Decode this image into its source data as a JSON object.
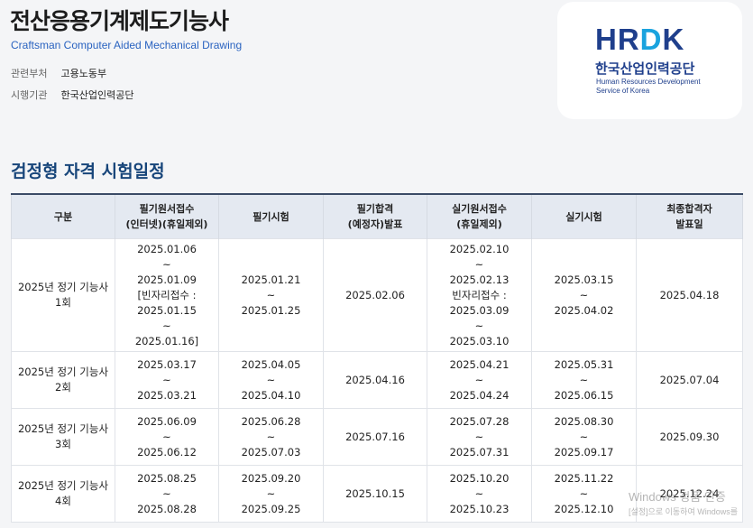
{
  "header": {
    "title": "전산응용기계제도기능사",
    "subtitle": "Craftsman Computer Aided Mechanical Drawing",
    "dept_label": "관련부처",
    "dept_value": "고용노동부",
    "agency_label": "시행기관",
    "agency_value": "한국산업인력공단"
  },
  "logo": {
    "mark_a": "HR",
    "mark_b": "D",
    "mark_c": "K",
    "kr": "한국산업인력공단",
    "en_line1": "Human Resources Development",
    "en_line2": "Service of Korea"
  },
  "section_title": "검정형 자격 시험일정",
  "table": {
    "headers": [
      "구분",
      "필기원서접수\n(인터넷)(휴일제외)",
      "필기시험",
      "필기합격\n(예정자)발표",
      "실기원서접수\n(휴일제외)",
      "실기시험",
      "최종합격자\n발표일"
    ],
    "rows": [
      [
        "2025년 정기 기능사 1회",
        "2025.01.06\n~\n2025.01.09\n[빈자리접수 :\n2025.01.15\n~\n2025.01.16]",
        "2025.01.21\n~\n2025.01.25",
        "2025.02.06",
        "2025.02.10\n~\n2025.02.13\n빈자리접수 :\n2025.03.09\n~\n2025.03.10",
        "2025.03.15\n~\n2025.04.02",
        "2025.04.18"
      ],
      [
        "2025년 정기 기능사 2회",
        "2025.03.17\n~\n2025.03.21",
        "2025.04.05\n~\n2025.04.10",
        "2025.04.16",
        "2025.04.21\n~\n2025.04.24",
        "2025.05.31\n~\n2025.06.15",
        "2025.07.04"
      ],
      [
        "2025년 정기 기능사 3회",
        "2025.06.09\n~\n2025.06.12",
        "2025.06.28\n~\n2025.07.03",
        "2025.07.16",
        "2025.07.28\n~\n2025.07.31",
        "2025.08.30\n~\n2025.09.17",
        "2025.09.30"
      ],
      [
        "2025년 정기 기능사 4회",
        "2025.08.25\n~\n2025.08.28",
        "2025.09.20\n~\n2025.09.25",
        "2025.10.15",
        "2025.10.20\n~\n2025.10.23",
        "2025.11.22\n~\n2025.12.10",
        "2025.12.24"
      ]
    ]
  },
  "watermark": {
    "line1": "Windows 정품 인증",
    "line2": "[설정]으로 이동하여 Windows를"
  },
  "colors": {
    "subtitle": "#2a63c0",
    "section_title": "#17457a",
    "logo_navy": "#1f3f8c",
    "logo_cyan": "#1aa3de",
    "table_header_bg": "#e4e9f1"
  }
}
